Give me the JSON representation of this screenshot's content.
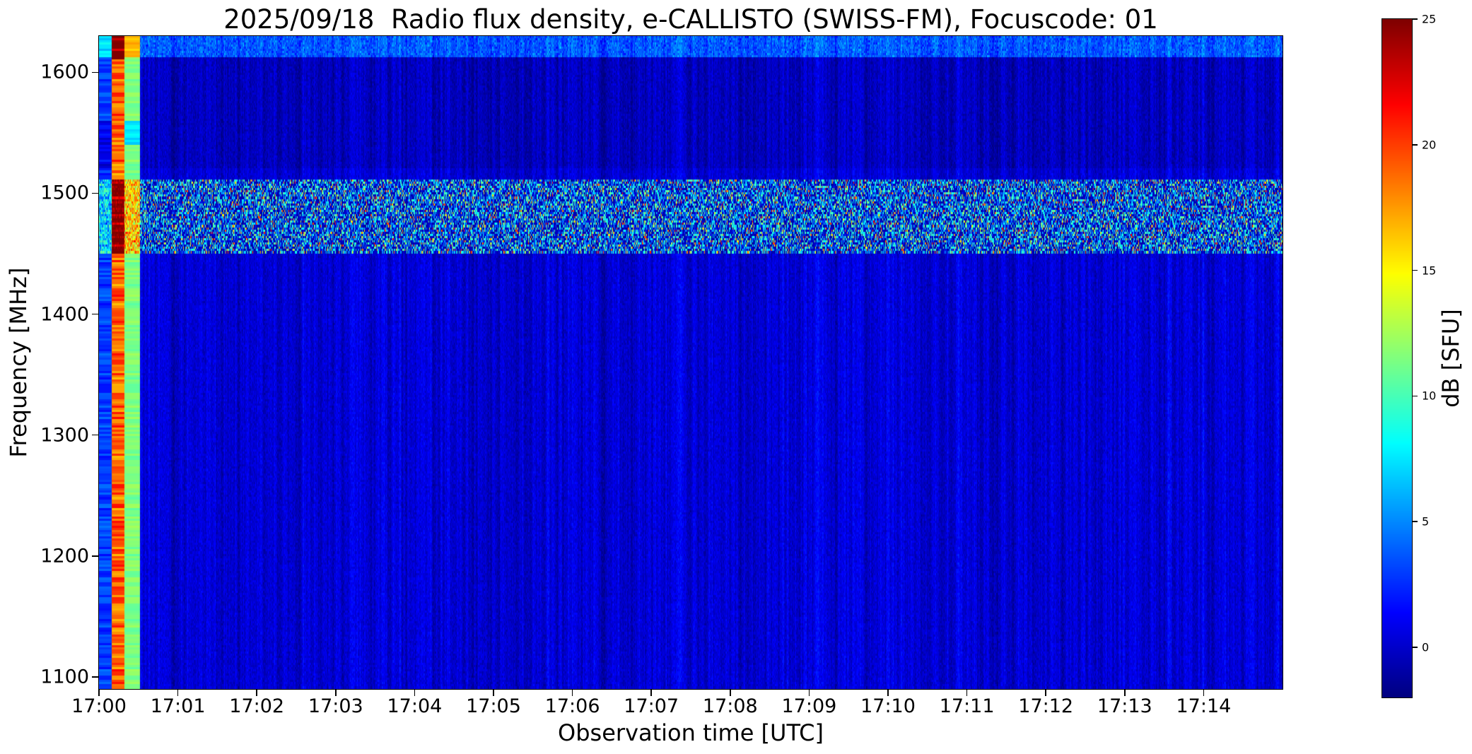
{
  "chart_data": {
    "type": "heatmap",
    "title": "2025/09/18  Radio flux density, e-CALLISTO (SWISS-FM), Focuscode: 01",
    "xlabel": "Observation time [UTC]",
    "ylabel": "Frequency [MHz]",
    "colorbar_label": "dB [SFU]",
    "colormap": "jet",
    "xlim": [
      "17:00:00",
      "17:15:00"
    ],
    "ylim": [
      1090,
      1630
    ],
    "clim": [
      -2,
      25
    ],
    "x_ticks": [
      "17:00",
      "17:01",
      "17:02",
      "17:03",
      "17:04",
      "17:05",
      "17:06",
      "17:07",
      "17:08",
      "17:09",
      "17:10",
      "17:11",
      "17:12",
      "17:13",
      "17:14"
    ],
    "y_ticks": [
      1100,
      1200,
      1300,
      1400,
      1500,
      1600
    ],
    "colorbar_ticks": [
      0,
      5,
      10,
      15,
      20,
      25
    ],
    "grid": false,
    "features": [
      {
        "time_start": "17:00:00",
        "time_end": "17:00:10",
        "freq_range": [
          1090,
          1630
        ],
        "level_db": 3
      },
      {
        "time_start": "17:00:10",
        "time_end": "17:00:19",
        "freq_range": [
          1090,
          1630
        ],
        "level_db": 19
      },
      {
        "time_start": "17:00:19",
        "time_end": "17:00:31",
        "freq_range": [
          1090,
          1630
        ],
        "level_db": 11
      },
      {
        "time_start": "17:00:31",
        "time_end": "17:15:00",
        "freq_range": [
          1450,
          1512
        ],
        "level_db": 6
      },
      {
        "time_start": "17:00:31",
        "time_end": "17:15:00",
        "freq_range": [
          1090,
          1450
        ],
        "level_db": 0.5
      },
      {
        "time_start": "17:00:31",
        "time_end": "17:15:00",
        "freq_range": [
          1512,
          1630
        ],
        "level_db": 1
      }
    ]
  }
}
